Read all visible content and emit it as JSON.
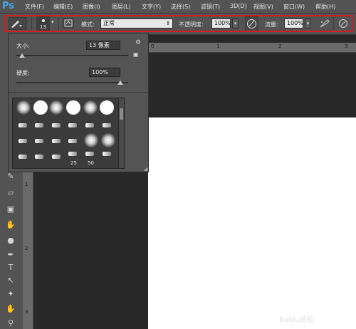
{
  "app": {
    "logo": "Ps"
  },
  "menu": [
    "文件(F)",
    "编辑(E)",
    "图像(I)",
    "图层(L)",
    "文字(Y)",
    "选择(S)",
    "滤镜(T)",
    "3D(D)",
    "视图(V)",
    "窗口(W)",
    "帮助(H)"
  ],
  "options": {
    "brush_size": "13",
    "mode_label": "模式:",
    "mode_value": "正常",
    "opacity_label": "不透明度:",
    "opacity_value": "100%",
    "flow_label": "流量:",
    "flow_value": "100%"
  },
  "brush_popup": {
    "size_label": "大小:",
    "size_value": "13 像素",
    "hardness_label": "硬度:",
    "hardness_value": "100%",
    "preset_numbers": [
      "25",
      "50"
    ]
  },
  "rulers": {
    "horizontal": [
      "0",
      "1",
      "2",
      "3"
    ],
    "vertical": [
      "1",
      "2",
      "3"
    ]
  },
  "watermark": "Baidu经验",
  "accent_colors": {
    "outline": "#d11f1f",
    "ps_blue": "#4aa3df"
  },
  "icons": [
    "brush-icon",
    "brush-panel-icon",
    "airbrush-icon",
    "pressure-opacity-icon",
    "pressure-size-icon",
    "gear-icon"
  ]
}
